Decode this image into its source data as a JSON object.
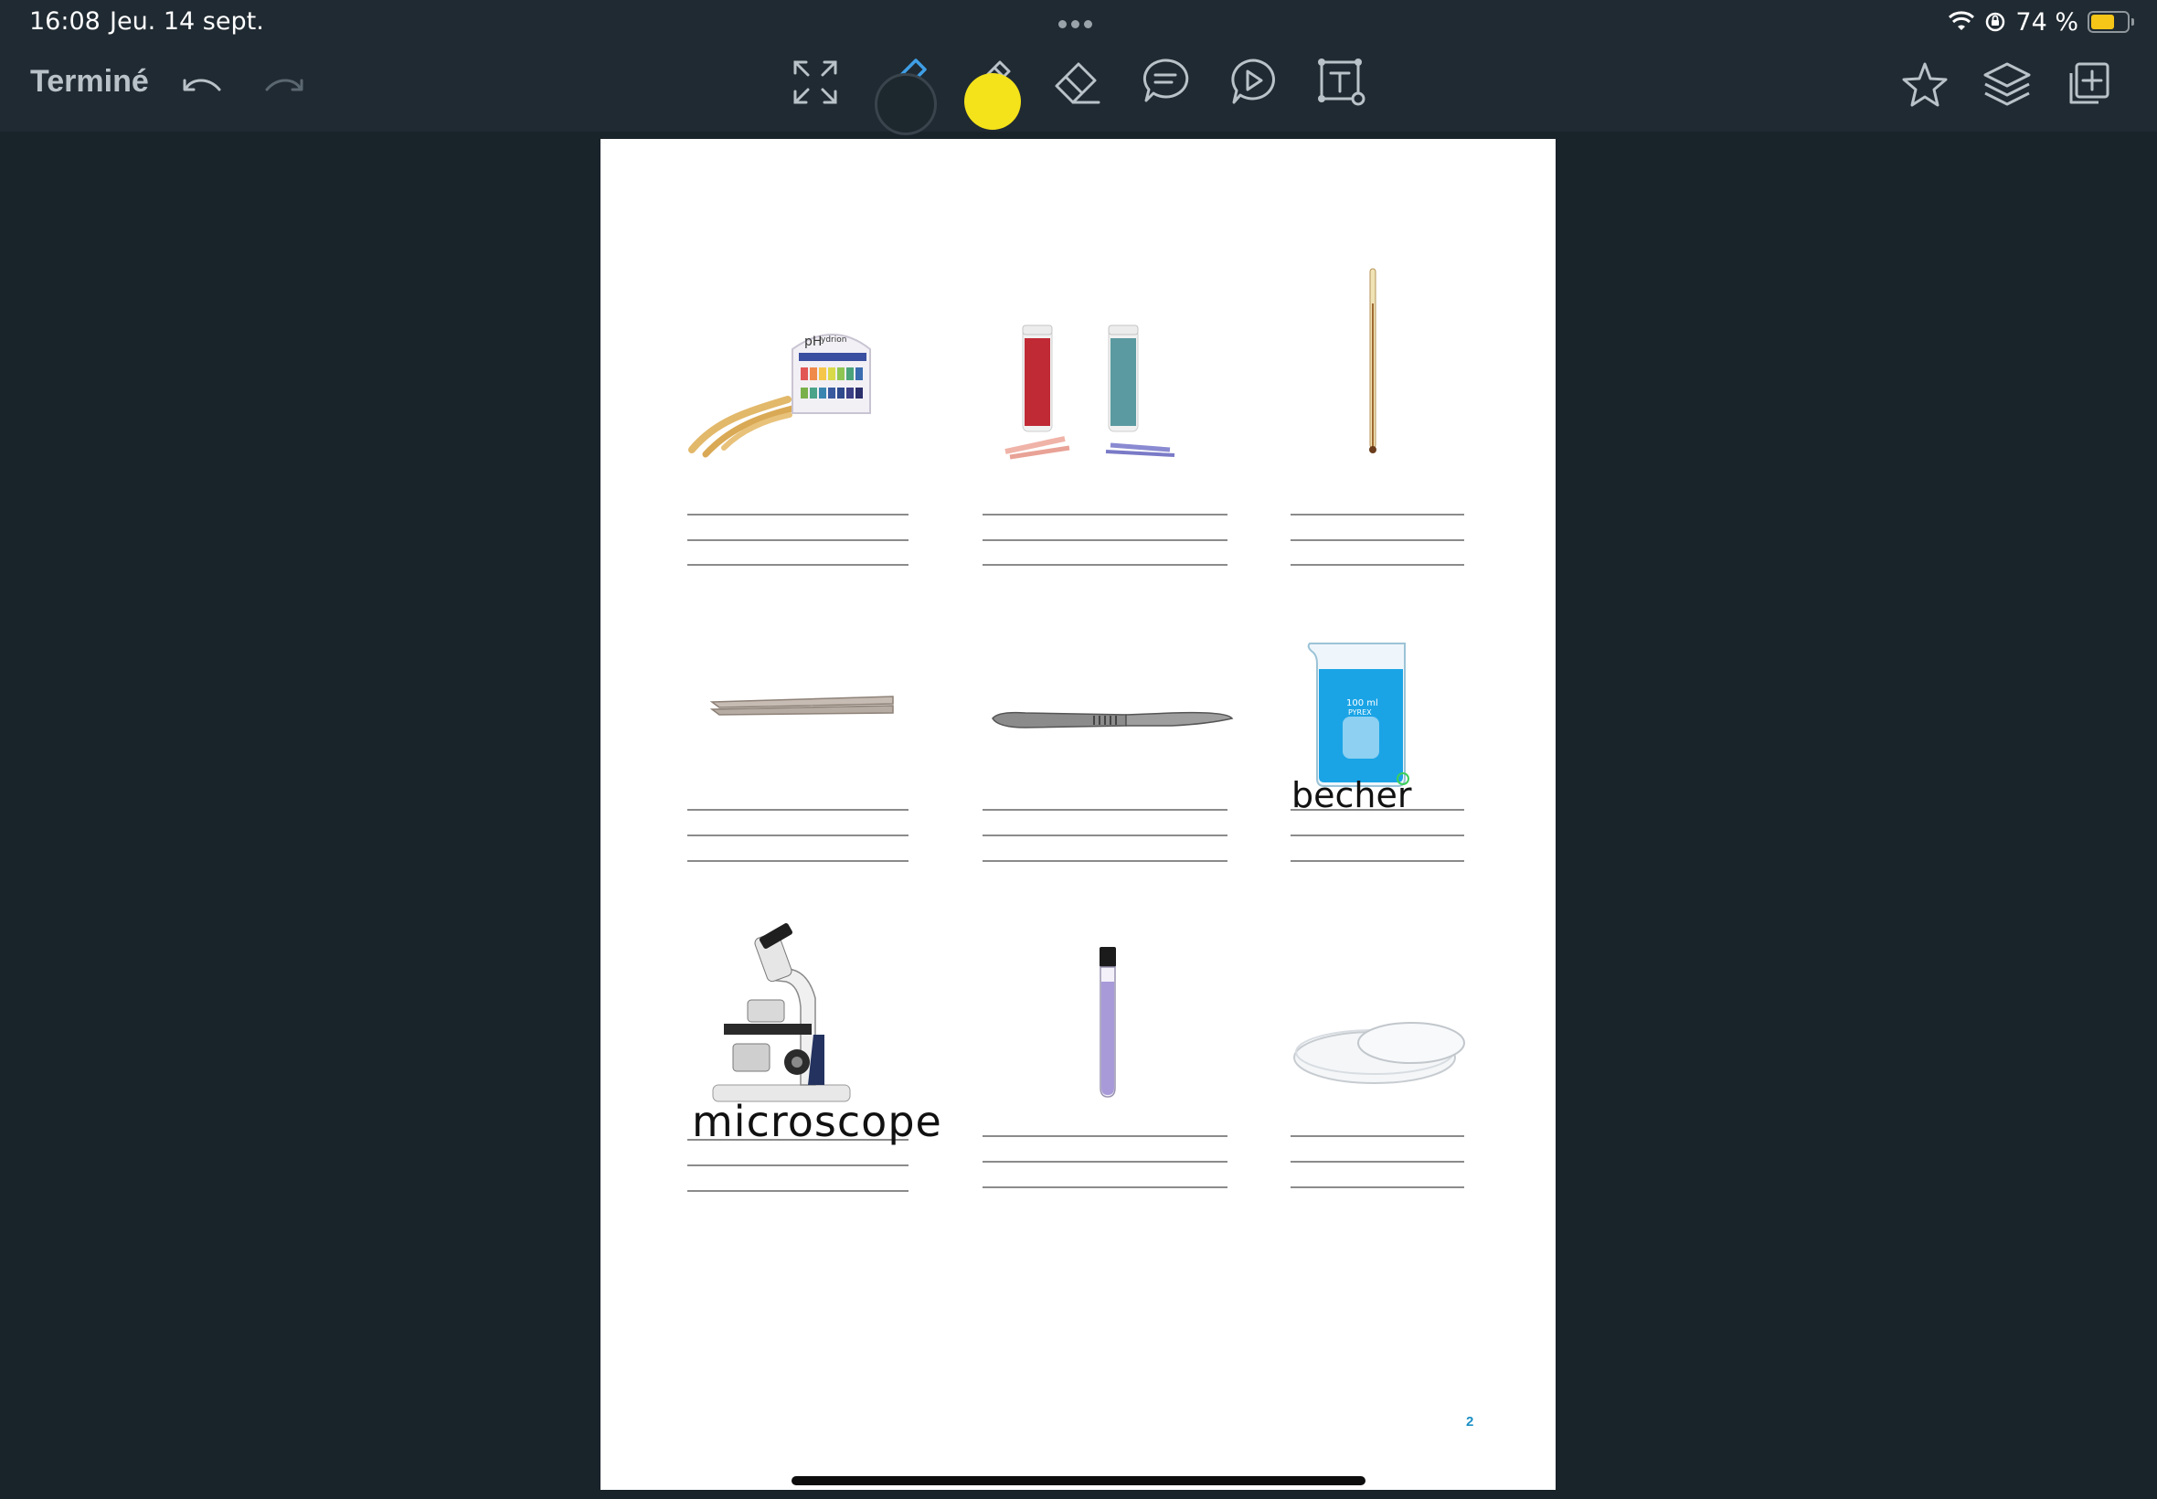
{
  "status_bar": {
    "time": "16:08",
    "date": "Jeu. 14 sept.",
    "battery_percent": "74 %",
    "battery_level": 0.74,
    "icons": [
      "wifi-icon",
      "orientation-lock-icon",
      "battery-icon"
    ]
  },
  "toolbar": {
    "done_label": "Terminé",
    "left_tools": [
      "undo-icon",
      "redo-icon"
    ],
    "center_tools": [
      "fullscreen-icon",
      "pen-icon",
      "highlighter-icon",
      "eraser-icon",
      "comment-icon",
      "play-icon",
      "text-box-icon"
    ],
    "right_tools": [
      "star-icon",
      "layers-icon",
      "add-page-icon"
    ],
    "selected_tool": "pen-icon",
    "colors": {
      "accent_blue": "#3f9fe6",
      "highlight_yellow": "#f4e21a"
    }
  },
  "worksheet": {
    "page_number": "2",
    "items": [
      {
        "name": "ph-paper",
        "handwritten_label": ""
      },
      {
        "name": "litmus-paper",
        "handwritten_label": ""
      },
      {
        "name": "thermometer",
        "handwritten_label": ""
      },
      {
        "name": "tweezers",
        "handwritten_label": ""
      },
      {
        "name": "scalpel",
        "handwritten_label": ""
      },
      {
        "name": "beaker",
        "handwritten_label": "becher"
      },
      {
        "name": "microscope",
        "handwritten_label": "microscope"
      },
      {
        "name": "test-tube",
        "handwritten_label": ""
      },
      {
        "name": "petri-dish",
        "handwritten_label": ""
      }
    ]
  }
}
